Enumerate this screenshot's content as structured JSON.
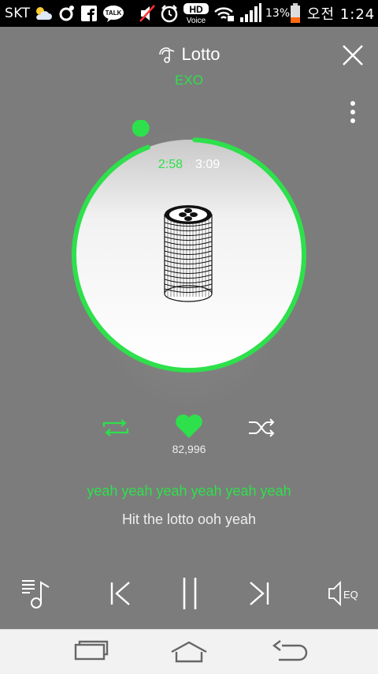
{
  "status_bar": {
    "carrier": "SKT",
    "hd_voice_top": "HD",
    "hd_voice_bottom": "Voice",
    "talk_label": "TALK",
    "battery_percent": "13%",
    "time": "오전 1:24"
  },
  "player": {
    "song_title": "Lotto",
    "artist": "EXO",
    "elapsed": "2:58",
    "separator": "·",
    "duration": "3:09",
    "progress_fraction": 0.942,
    "like_count": "82,996",
    "lyric_current": "yeah yeah yeah yeah yeah yeah",
    "lyric_next": "Hit the lotto ooh yeah",
    "eq_label": "EQ"
  },
  "colors": {
    "accent": "#2ee04b",
    "background": "#7c7c7c",
    "nav_bar": "#f2f2f2"
  }
}
